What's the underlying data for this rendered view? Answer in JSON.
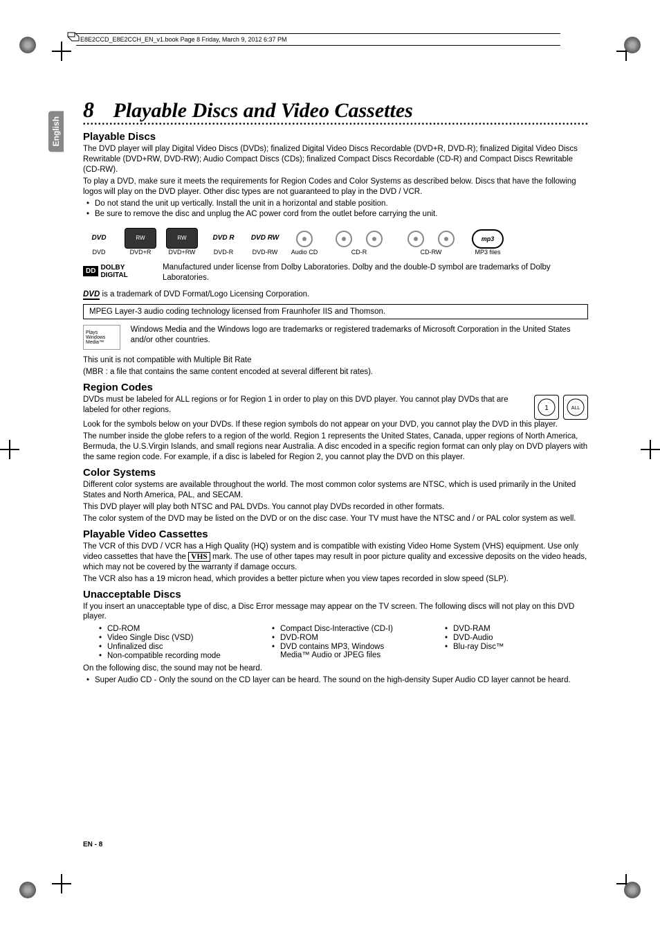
{
  "header_path": "E8E2CCD_E8E2CCH_EN_v1.book  Page 8  Friday, March 9, 2012  6:37 PM",
  "lang_tab": "English",
  "chapter": {
    "number": "8",
    "title": "Playable Discs and Video Cassettes"
  },
  "playable_discs": {
    "heading": "Playable Discs",
    "p1": "The DVD player will play Digital Video Discs (DVDs); finalized Digital Video Discs Recordable (DVD+R, DVD-R); finalized Digital Video Discs Rewritable (DVD+RW, DVD-RW); Audio Compact Discs (CDs); finalized Compact Discs Recordable (CD-R) and Compact Discs Rewritable (CD-RW).",
    "p2": "To play a DVD, make sure it meets the requirements for Region Codes and Color Systems as described below. Discs that have the following logos will play on the DVD player. Other disc types are not guaranteed to play in the DVD / VCR.",
    "b1": "Do not stand the unit up vertically. Install the unit in a horizontal and stable position.",
    "b2": "Be sure to remove the disc and unplug the AC power cord from the outlet before carrying the unit."
  },
  "logos": [
    {
      "label": "DVD"
    },
    {
      "label": "DVD+R"
    },
    {
      "label": "DVD+RW"
    },
    {
      "label": "DVD-R"
    },
    {
      "label": "DVD-RW"
    },
    {
      "label": "Audio CD"
    },
    {
      "label": "CD-R"
    },
    {
      "label": "CD-RW"
    },
    {
      "label": "MP3 files"
    }
  ],
  "dolby": {
    "text": "Manufactured under license from Dolby Laboratories. Dolby and the double-D symbol are trademarks of Dolby Laboratories.",
    "label": "DOLBY DIGITAL"
  },
  "dvd_tm": "is a trademark of DVD Format/Logo Licensing Corporation.",
  "mpeg": "MPEG Layer-3 audio coding technology licensed from Fraunhofer IIS and Thomson.",
  "windows": {
    "text": "Windows Media and the Windows logo are trademarks or registered trademarks of Microsoft Corporation in the United States and/or other countries.",
    "label": "Plays Windows Media™"
  },
  "mbr": {
    "l1": "This unit is not compatible with Multiple Bit Rate",
    "l2": "(MBR : a file that contains the same content encoded at several different bit rates)."
  },
  "region": {
    "heading": "Region Codes",
    "p1": "DVDs must be labeled for ALL regions or for Region 1 in order to play on this DVD player. You cannot play DVDs that are labeled for other regions.",
    "p2": "Look for the symbols below on your DVDs. If these region symbols do not appear on your DVD, you cannot play the DVD in this player.",
    "p3": "The number inside the globe refers to a region of the world. Region 1 represents the United States, Canada, upper regions of North America, Bermuda, the U.S.Virgin Islands, and small regions near Australia. A disc encoded in a specific region format can only play on DVD players with the same region code. For example, if a disc is labeled for Region 2, you cannot play the DVD on this player.",
    "icon1": "1",
    "icon2": "ALL"
  },
  "color": {
    "heading": "Color Systems",
    "p1": "Different color systems are available throughout the world. The most common color systems are NTSC, which is used primarily in the United States and North America, PAL, and SECAM.",
    "p2": "This DVD player will play both NTSC and PAL DVDs. You cannot play DVDs recorded in other formats.",
    "p3": "The color system of the DVD may be listed on the DVD or on the disc case. Your TV must have the NTSC and / or PAL color system as well."
  },
  "vcr": {
    "heading": "Playable Video Cassettes",
    "p1a": "The VCR of this DVD / VCR has a High Quality (HQ) system and is compatible with existing Video Home System (VHS) equipment. Use only video cassettes that have the ",
    "p1b": " mark. The use of other tapes may result in poor picture quality and excessive deposits on the video heads, which may not be covered by the warranty if damage occurs.",
    "p2": "The VCR also has a 19 micron head, which provides a better picture when you view tapes recorded in slow speed (SLP).",
    "vhs": "VHS"
  },
  "unacceptable": {
    "heading": "Unacceptable Discs",
    "p1": "If you insert an unacceptable type of disc, a Disc Error message may appear on the TV screen. The following discs will not play on this DVD player.",
    "col1": [
      "CD-ROM",
      "Video Single Disc (VSD)",
      "Unfinalized disc",
      "Non-compatible recording mode"
    ],
    "col2": [
      "Compact Disc-Interactive (CD-I)",
      "DVD-ROM",
      "DVD contains MP3, Windows Media™ Audio or JPEG files"
    ],
    "col3": [
      "DVD-RAM",
      "DVD-Audio",
      "Blu-ray Disc™"
    ],
    "p2": "On the following disc, the sound may not be heard.",
    "p3": "Super Audio CD - Only the sound on the CD layer can be heard. The sound on the high-density Super Audio CD layer cannot be heard."
  },
  "footer": {
    "lang": "EN",
    "sep": " - ",
    "page": "8"
  }
}
